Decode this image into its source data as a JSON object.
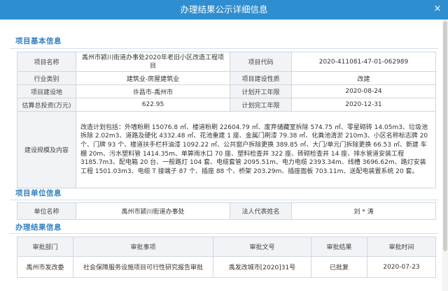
{
  "dialog": {
    "title": "办理结果公示详细信息",
    "close_label": "×"
  },
  "basic": {
    "section_title": "项目基本信息",
    "rows": [
      {
        "l1": "项目名称",
        "v1": "禹州市颍川街道办事处2020年老旧小区改造工程项目",
        "l2": "项目代码",
        "v2": "2020-411081-47-01-062989"
      },
      {
        "l1": "行业类别",
        "v1": "建筑业-房屋建筑业",
        "l2": "项目建设性质",
        "v2": "改建"
      },
      {
        "l1": "项目建设地",
        "v1": "许昌市-禹州市",
        "l2": "计划开工年限",
        "v2": "2020-08-24"
      },
      {
        "l1": "估算总投资(万元)",
        "v1": "622.95",
        "l2": "计划完工年限",
        "v2": "2020-12-31"
      }
    ],
    "scale_label": "建设规模及内容",
    "scale_text": "改造计划包括：外墙粉刷 15076.8 ㎡、楼道粉刷 22604.79 ㎡、废弃储藏室拆除 574.75 ㎡、零星砌砖 14.05m3、垃圾池拆除 2.02m3、道路及硬化 4332.48 ㎡、花池重建 1 座、金属门刷漆 79.38 ㎡、化粪池清淤 210m3、小区名称标志牌 20 个、门牌 93 个、楼道扶手栏杆油漆 1092.22 ㎡、公共窗户拆除更换 389.85 ㎡、大门/单元门拆除更换 66.53 ㎡、新建 车棚 20m、污水塑料管 1414.35m、单箅雨水口 70 座、塑料检查井 322 座、砖砌检查井 14 座、排水管道安装工程 3185.7m3、配电箱 20 台、一般路灯 104 套、电缆套管 2095.51m、电力电缆 2393.34m、线槽 3696.62m、路灯安装工程 1501.03m3、电缆 T 接端子 87 个、插座 88 个、桥架 203.29m、插座面板 703.11m、送配电装置系统 20 套。"
  },
  "unit": {
    "section_title": "项目单位信息",
    "l1": "单位名称",
    "v1": "禹州市颍川街道办事处",
    "l2": "法人代表姓名",
    "v2": "刘 * 涛"
  },
  "result": {
    "section_title": "办理结果信息",
    "headers": [
      "审批部门",
      "审批事项",
      "审批文号",
      "审批结果",
      "审批时间"
    ],
    "rows": [
      [
        "禹州市发改委",
        "社会保障服务设施项目可行性研究报告审批",
        "禹发改城市[2020]31号",
        "已批复",
        "2020-07-23"
      ]
    ]
  }
}
